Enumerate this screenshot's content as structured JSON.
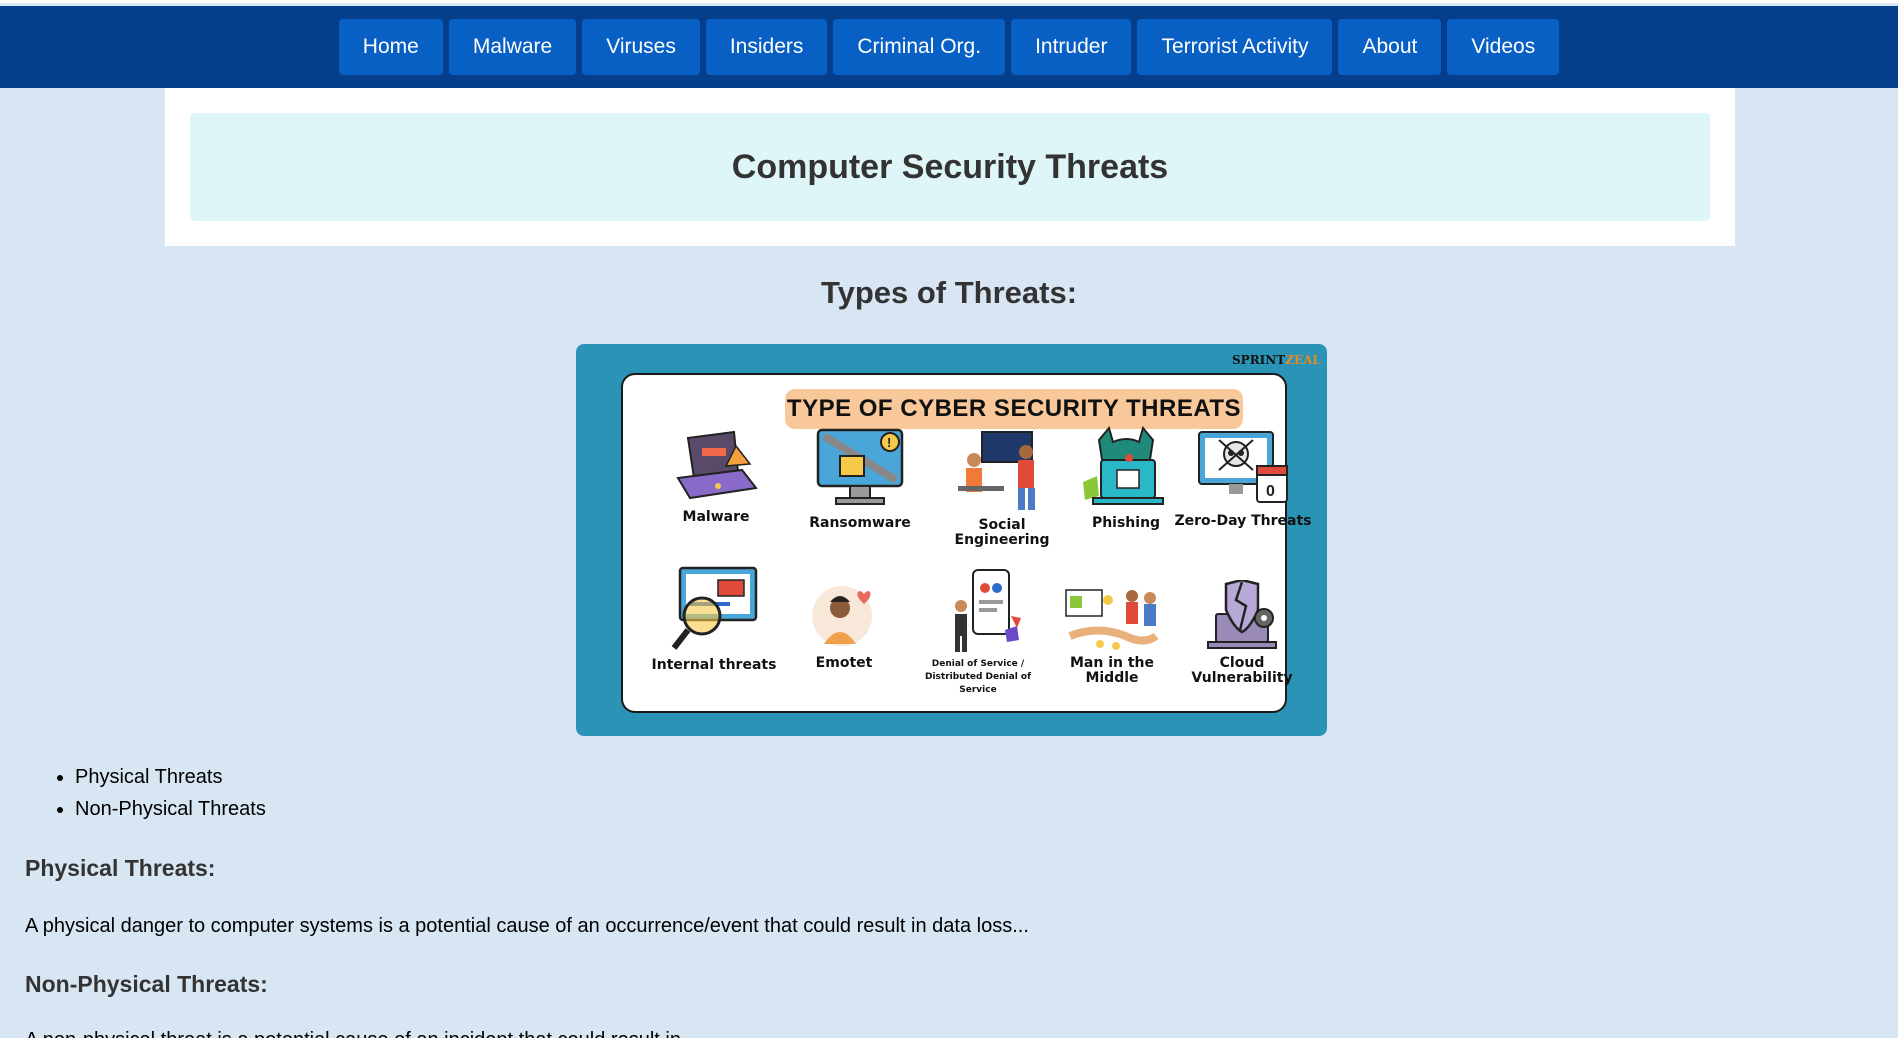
{
  "nav": {
    "items": [
      "Home",
      "Malware",
      "Viruses",
      "Insiders",
      "Criminal Org.",
      "Intruder",
      "Terrorist Activity",
      "About",
      "Videos"
    ]
  },
  "header": {
    "title": "Computer Security Threats"
  },
  "section": {
    "heading": "Types of Threats:"
  },
  "infographic": {
    "banner": "TYPE OF CYBER SECURITY THREATS",
    "brand_main": "SPRINT",
    "brand_accent": "ZEAL",
    "threats": [
      {
        "label": "Malware",
        "icon": "laptop-malware-icon"
      },
      {
        "label": "Ransomware",
        "icon": "monitor-chain-lock-icon"
      },
      {
        "label": "Social Engineering",
        "icon": "people-desk-icon"
      },
      {
        "label": "Phishing",
        "icon": "hacker-laptop-icon"
      },
      {
        "label": "Zero-Day Threats",
        "icon": "skull-monitor-calendar-icon"
      },
      {
        "label": "Internal threats",
        "icon": "magnifier-monitor-bug-icon"
      },
      {
        "label": "Emotet",
        "icon": "person-heart-icon"
      },
      {
        "label": "Denial of Service / Distributed Denial of Service",
        "icon": "phone-user-icon"
      },
      {
        "label": "Man in the Middle",
        "icon": "people-exchange-icon"
      },
      {
        "label": "Cloud Vulnerability",
        "icon": "broken-shield-laptop-icon"
      }
    ],
    "colors": {
      "frame": "#2a93b6",
      "banner": "#f8c79a"
    }
  },
  "list": [
    "Physical Threats",
    "Non-Physical Threats"
  ],
  "physical": {
    "heading": "Physical Threats:",
    "text": "A physical danger to computer systems is a potential cause of an occurrence/event that could result in data loss..."
  },
  "nonphysical": {
    "heading": "Non-Physical Threats:",
    "text": "A non-physical threat is a potential cause of an incident that could result in"
  },
  "colors": {
    "nav_bg": "#053f8c",
    "nav_button": "#0860c4",
    "page_bg": "#d8e6f4",
    "title_box": "#dff6f9"
  }
}
